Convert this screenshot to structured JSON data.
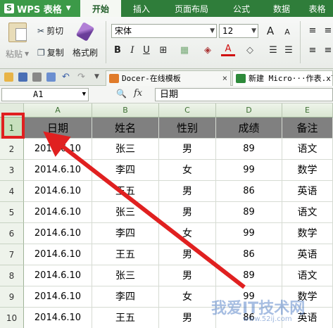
{
  "app": {
    "name": "WPS 表格",
    "logo": "S"
  },
  "menu": [
    "开始",
    "插入",
    "页面布局",
    "公式",
    "数据",
    "表格"
  ],
  "ribbon": {
    "paste": "粘贴",
    "cut": "剪切",
    "copy": "复制",
    "format_painter": "格式刷",
    "font_name": "宋体",
    "font_size": "12",
    "bold": "B",
    "italic": "I",
    "underline": "U",
    "font_color_glyph": "A",
    "grow_font": "A",
    "shrink_font": "A"
  },
  "tabs": [
    {
      "label": "Docer-在线模板"
    },
    {
      "label": "新建 Micro···作表.xl"
    }
  ],
  "formula_bar": {
    "cell_ref": "A1",
    "fx": "fx",
    "content": "日期"
  },
  "columns": [
    "A",
    "B",
    "C",
    "D",
    "E"
  ],
  "rows": [
    "1",
    "2",
    "3",
    "4",
    "5",
    "6",
    "7",
    "8",
    "9",
    "10"
  ],
  "header_row": [
    "日期",
    "姓名",
    "性别",
    "成绩",
    "备注"
  ],
  "data_rows": [
    [
      "2014.6.10",
      "张三",
      "男",
      "89",
      "语文"
    ],
    [
      "2014.6.10",
      "李四",
      "女",
      "99",
      "数学"
    ],
    [
      "2014.6.10",
      "王五",
      "男",
      "86",
      "英语"
    ],
    [
      "2014.6.10",
      "张三",
      "男",
      "89",
      "语文"
    ],
    [
      "2014.6.10",
      "李四",
      "女",
      "99",
      "数学"
    ],
    [
      "2014.6.10",
      "王五",
      "男",
      "86",
      "英语"
    ],
    [
      "2014.6.10",
      "张三",
      "男",
      "89",
      "语文"
    ],
    [
      "2014.6.10",
      "李四",
      "女",
      "99",
      "数学"
    ],
    [
      "2014.6.10",
      "王五",
      "男",
      "86",
      "英语"
    ]
  ],
  "watermark": {
    "text": "我爱IT技术网",
    "sub": "www.52ij.com"
  },
  "colors": {
    "menubar": "#2f7d3a",
    "header_fill": "#808080",
    "annotation": "#e02020"
  }
}
